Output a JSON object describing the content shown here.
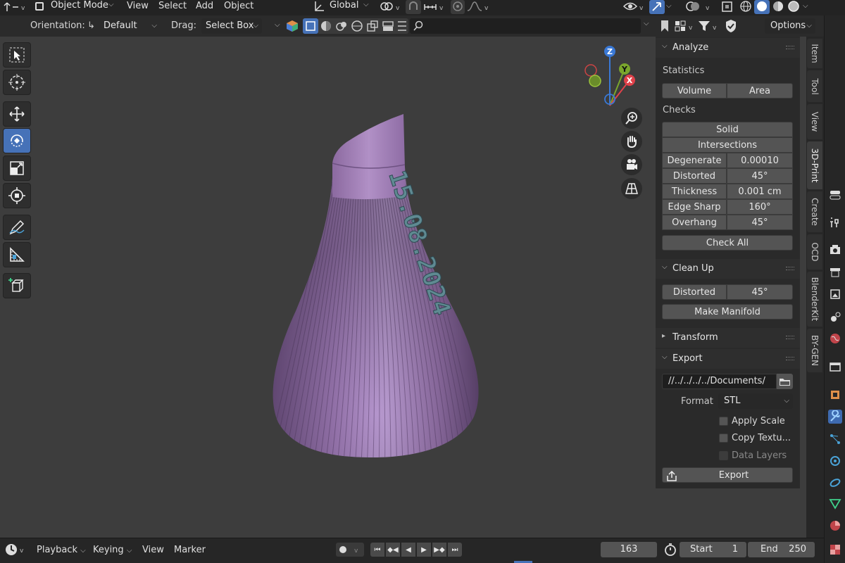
{
  "header": {
    "mode": "Object Mode",
    "menus": [
      "View",
      "Select",
      "Add",
      "Object"
    ],
    "transform_orientation": "Global"
  },
  "toolheader": {
    "orientation_label": "Orientation:",
    "orientation_value": "Default",
    "drag_label": "Drag:",
    "drag_value": "Select Box",
    "options_label": "Options"
  },
  "toolbar": {
    "tools": [
      "select-box",
      "cursor",
      "move",
      "rotate",
      "scale",
      "transform",
      "annotate",
      "measure",
      "add-cube"
    ],
    "active": "rotate"
  },
  "viewport": {
    "embossed_text": "15.08.2024",
    "gizmo": {
      "z": "Z",
      "y": "Y",
      "x": "X"
    }
  },
  "sidebar_tabs": [
    "Item",
    "Tool",
    "View",
    "3D-Print",
    "Create",
    "OCD",
    "BlenderKit",
    "BY-GEN"
  ],
  "sidebar_active_tab": "3D-Print",
  "analyze": {
    "title": "Analyze",
    "statistics_label": "Statistics",
    "volume_btn": "Volume",
    "area_btn": "Area",
    "checks_label": "Checks",
    "solid_btn": "Solid",
    "intersections_btn": "Intersections",
    "rows": [
      {
        "label": "Degenerate",
        "value": "0.00010"
      },
      {
        "label": "Distorted",
        "value": "45°"
      },
      {
        "label": "Thickness",
        "value": "0.001 cm"
      },
      {
        "label": "Edge Sharp",
        "value": "160°"
      },
      {
        "label": "Overhang",
        "value": "45°"
      }
    ],
    "check_all_btn": "Check All"
  },
  "cleanup": {
    "title": "Clean Up",
    "distorted_label": "Distorted",
    "distorted_value": "45°",
    "make_manifold_btn": "Make Manifold"
  },
  "transform": {
    "title": "Transform"
  },
  "export": {
    "title": "Export",
    "path": "//../../../../Documents/",
    "format_label": "Format",
    "format_value": "STL",
    "apply_scale": "Apply Scale",
    "copy_textures": "Copy Textu...",
    "data_layers": "Data Layers",
    "export_btn": "Export"
  },
  "timeline": {
    "playback": "Playback",
    "keying": "Keying",
    "view": "View",
    "marker": "Marker",
    "current_frame": "163",
    "start_label": "Start",
    "start_value": "1",
    "end_label": "End",
    "end_value": "250"
  },
  "colors": {
    "accent": "#4672b8",
    "object": "#9e7ab6",
    "text_emboss": "#5f8a92",
    "gizmo_x": "#e0414a",
    "gizmo_y": "#7aa62c",
    "gizmo_z": "#3a79d6"
  }
}
